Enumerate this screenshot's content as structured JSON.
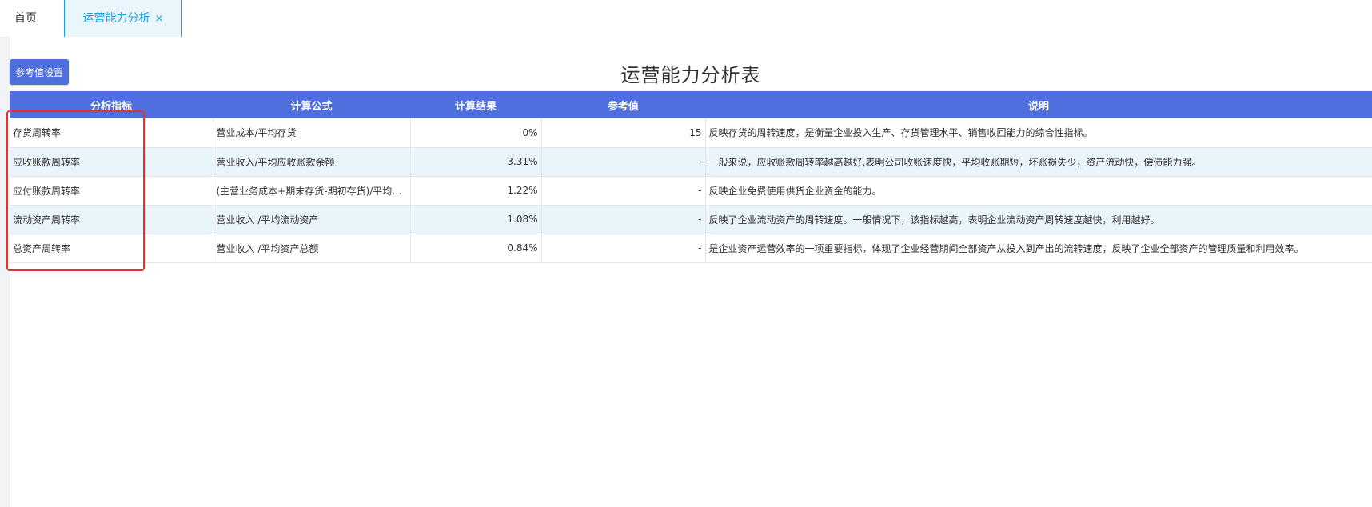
{
  "tabs": {
    "home": "首页",
    "active": "运营能力分析",
    "close_glyph": "×"
  },
  "toolbar": {
    "settings_label": "参考值设置"
  },
  "title": "运营能力分析表",
  "table": {
    "headers": [
      "分析指标",
      "计算公式",
      "计算结果",
      "参考值",
      "说明"
    ],
    "rows": [
      {
        "indicator": "存货周转率",
        "formula": "营业成本/平均存货",
        "result": "0%",
        "reference": "15",
        "description": "反映存货的周转速度，是衡量企业投入生产、存货管理水平、销售收回能力的综合性指标。"
      },
      {
        "indicator": "应收账款周转率",
        "formula": "营业收入/平均应收账款余额",
        "result": "3.31%",
        "reference": "-",
        "description": "一般来说，应收账款周转率越高越好,表明公司收账速度快，平均收账期短，坏账损失少，资产流动快，偿债能力强。"
      },
      {
        "indicator": "应付账款周转率",
        "formula": "(主营业务成本+期末存货-期初存货)/平均应付...",
        "result": "1.22%",
        "reference": "-",
        "description": "反映企业免费使用供货企业资金的能力。"
      },
      {
        "indicator": "流动资产周转率",
        "formula": "营业收入 /平均流动资产",
        "result": "1.08%",
        "reference": "-",
        "description": "反映了企业流动资产的周转速度。一般情况下，该指标越高，表明企业流动资产周转速度越快，利用越好。"
      },
      {
        "indicator": "总资产周转率",
        "formula": "营业收入 /平均资产总额",
        "result": "0.84%",
        "reference": "-",
        "description": "是企业资产运营效率的一项重要指标，体现了企业经营期间全部资产从投入到产出的流转速度，反映了企业全部资产的管理质量和利用效率。"
      }
    ]
  },
  "colors": {
    "header_bg": "#4f6fde",
    "tab_active_text": "#1e9fd6",
    "highlight_border": "#e8312c"
  }
}
